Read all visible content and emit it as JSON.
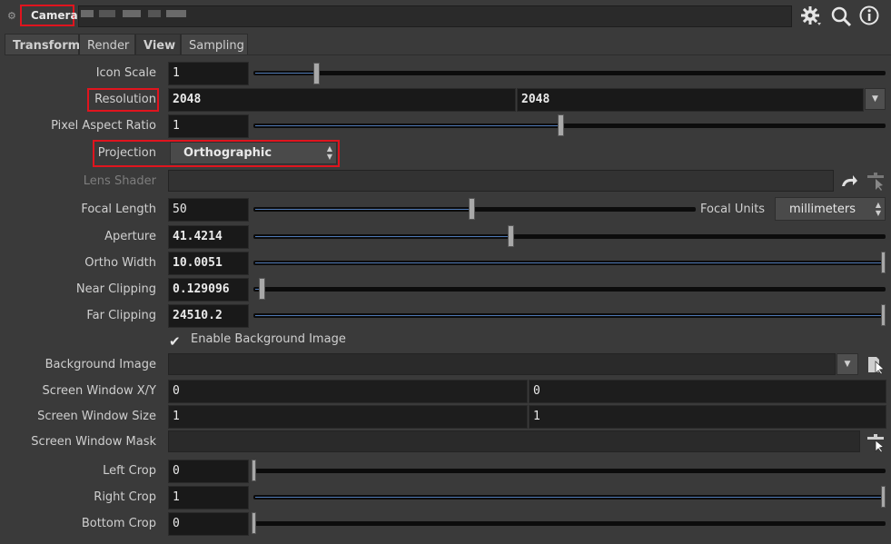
{
  "header": {
    "node_label": "Camera",
    "icons": [
      "gear-icon",
      "search-icon",
      "info-icon"
    ]
  },
  "tabs": [
    "Transform",
    "Render",
    "View",
    "Sampling"
  ],
  "rows": {
    "icon_scale": {
      "label": "Icon Scale",
      "value": "1",
      "slider": 0.1
    },
    "resolution": {
      "label": "Resolution",
      "x": "2048",
      "y": "2048"
    },
    "pixel_aspect": {
      "label": "Pixel Aspect Ratio",
      "value": "1",
      "slider": 0.5
    },
    "projection": {
      "label": "Projection",
      "value": "Orthographic"
    },
    "lens_shader": {
      "label": "Lens Shader",
      "value": ""
    },
    "focal_length": {
      "label": "Focal Length",
      "value": "50",
      "slider": 0.5,
      "units_label": "Focal Units",
      "units_value": "millimeters"
    },
    "aperture": {
      "label": "Aperture",
      "value": "41.4214",
      "slider": 0.41
    },
    "ortho_width": {
      "label": "Ortho Width",
      "value": "10.0051",
      "slider": 1.0
    },
    "near_clipping": {
      "label": "Near Clipping",
      "value": "0.129096",
      "slider": 0.01
    },
    "far_clipping": {
      "label": "Far Clipping",
      "value": "24510.2",
      "slider": 1.0
    },
    "enable_bg": {
      "label": "Enable Background Image",
      "checked": true
    },
    "background_image": {
      "label": "Background Image",
      "value": ""
    },
    "screen_window_xy": {
      "label": "Screen Window X/Y",
      "x": "0",
      "y": "0"
    },
    "screen_window_size": {
      "label": "Screen Window Size",
      "x": "1",
      "y": "1"
    },
    "screen_window_mask": {
      "label": "Screen Window Mask",
      "value": ""
    },
    "left_crop": {
      "label": "Left Crop",
      "value": "0",
      "slider": 0.0
    },
    "right_crop": {
      "label": "Right Crop",
      "value": "1",
      "slider": 1.0
    },
    "bottom_crop": {
      "label": "Bottom Crop",
      "value": "0",
      "slider": 0.0
    }
  },
  "colors": {
    "highlight": "#e0141e",
    "slider_fill": "#4f79b5"
  }
}
